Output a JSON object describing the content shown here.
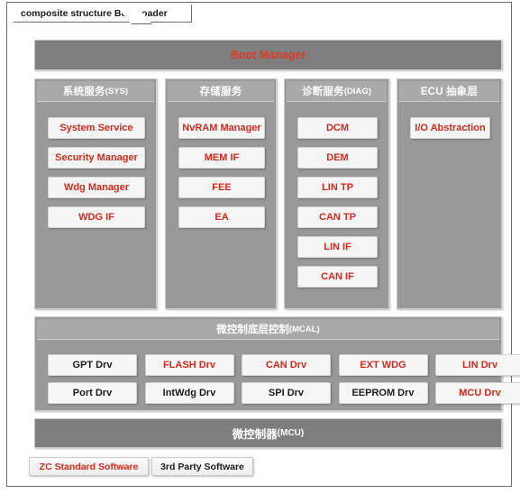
{
  "frame": {
    "tab_label": "composite structure BootLoader"
  },
  "boot_manager": {
    "label": "Boot Manager"
  },
  "columns": [
    {
      "header_main": "系统服务 ",
      "header_suffix": "(SYS)",
      "items": [
        {
          "label": "System Service",
          "style": "red"
        },
        {
          "label": "Security Manager",
          "style": "red"
        },
        {
          "label": "Wdg Manager",
          "style": "red"
        },
        {
          "label": "WDG IF",
          "style": "red"
        }
      ]
    },
    {
      "header_main": "存储服务",
      "header_suffix": "",
      "items": [
        {
          "label": "NvRAM Manager",
          "style": "red"
        },
        {
          "label": "MEM IF",
          "style": "red"
        },
        {
          "label": "FEE",
          "style": "red"
        },
        {
          "label": "EA",
          "style": "red"
        }
      ]
    },
    {
      "header_main": "诊断服务",
      "header_suffix": "(DIAG)",
      "items": [
        {
          "label": "DCM",
          "style": "red"
        },
        {
          "label": "DEM",
          "style": "red"
        },
        {
          "label": "LIN TP",
          "style": "red"
        },
        {
          "label": "CAN TP",
          "style": "red"
        },
        {
          "label": "LIN IF",
          "style": "red"
        },
        {
          "label": "CAN IF",
          "style": "red"
        }
      ]
    },
    {
      "header_main": "ECU 抽象层",
      "header_suffix": "",
      "items": [
        {
          "label": "I/O Abstraction",
          "style": "red"
        }
      ]
    }
  ],
  "mcal": {
    "header_main": "微控制底层控制",
    "header_suffix": "(MCAL)",
    "rows": [
      [
        {
          "label": "GPT Drv",
          "style": "dark"
        },
        {
          "label": "FLASH Drv",
          "style": "red"
        },
        {
          "label": "CAN Drv",
          "style": "red"
        },
        {
          "label": "EXT WDG",
          "style": "red"
        },
        {
          "label": "LIN Drv",
          "style": "red"
        }
      ],
      [
        {
          "label": "Port Drv",
          "style": "dark"
        },
        {
          "label": "IntWdg Drv",
          "style": "dark"
        },
        {
          "label": "SPI Drv",
          "style": "dark"
        },
        {
          "label": "EEPROM Drv",
          "style": "dark"
        },
        {
          "label": "MCU Drv",
          "style": "red"
        }
      ]
    ]
  },
  "mcu": {
    "label_main": "微控制器",
    "label_suffix": "(MCU)"
  },
  "legend": [
    {
      "label": "ZC Standard Software",
      "style": "red"
    },
    {
      "label": "3rd Party Software",
      "style": "dark"
    }
  ],
  "colors": {
    "accent_red": "#d8281a",
    "bar_grey": "#7e7e7e",
    "column_grey": "#999999",
    "header_grey": "#a9a9a9",
    "chip_bg": "#f6f6f6"
  }
}
